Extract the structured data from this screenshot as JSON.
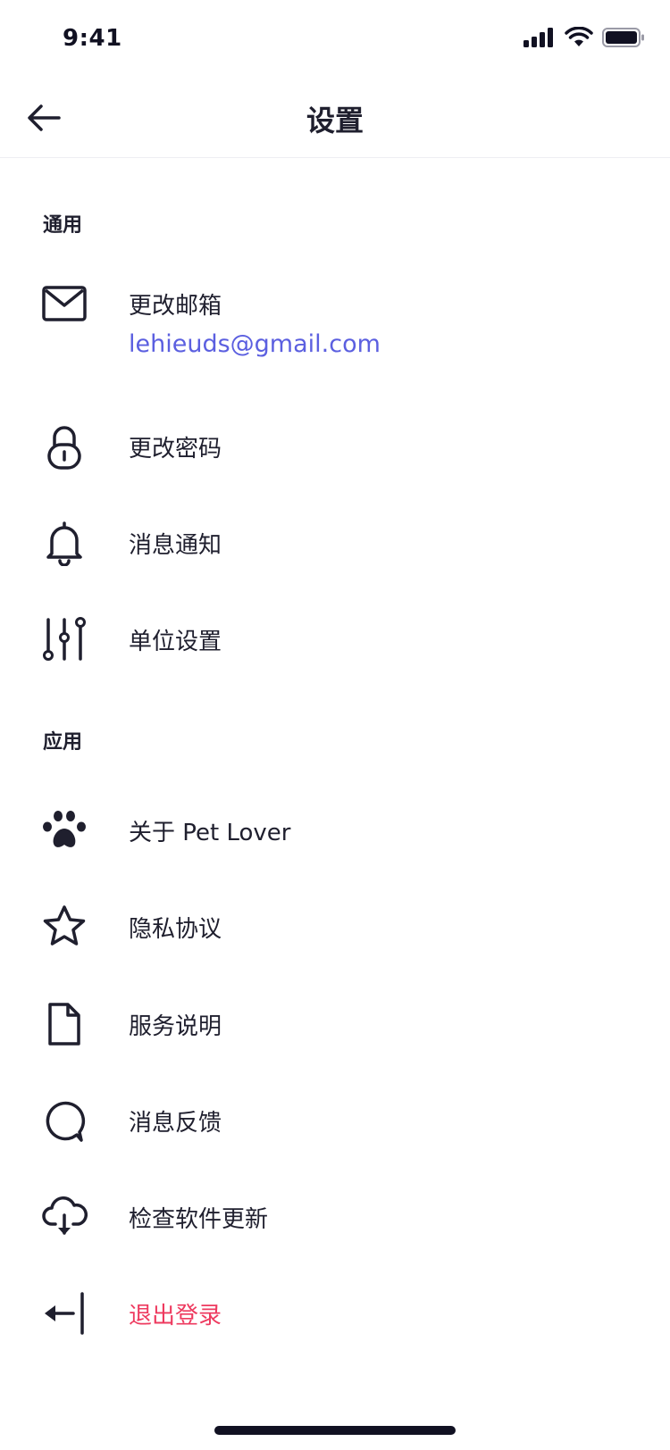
{
  "status_bar": {
    "time": "9:41",
    "icons": [
      "cellular-signal-icon",
      "wifi-icon",
      "battery-icon"
    ]
  },
  "nav": {
    "title": "设置",
    "back_icon": "arrow-left-icon"
  },
  "sections": {
    "general": {
      "header": "通用",
      "items": [
        {
          "label": "更改邮箱",
          "value": "lehieuds@gmail.com",
          "icon": "mail-icon"
        },
        {
          "label": "更改密码",
          "icon": "lock-icon"
        },
        {
          "label": "消息通知",
          "icon": "bell-icon"
        },
        {
          "label": "单位设置",
          "icon": "sliders-icon"
        }
      ]
    },
    "app": {
      "header": "应用",
      "items": [
        {
          "label": "关于 Pet Lover",
          "icon": "paw-icon"
        },
        {
          "label": "隐私协议",
          "icon": "star-icon"
        },
        {
          "label": "服务说明",
          "icon": "document-icon"
        },
        {
          "label": "消息反馈",
          "icon": "chat-bubble-icon"
        },
        {
          "label": "检查软件更新",
          "icon": "cloud-download-icon"
        },
        {
          "label": "退出登录",
          "icon": "logout-icon"
        }
      ]
    }
  },
  "colors": {
    "text": "#1f1f2e",
    "accent": "#5b5fe0",
    "danger": "#ee3a5f",
    "divider": "#eeeef2"
  }
}
